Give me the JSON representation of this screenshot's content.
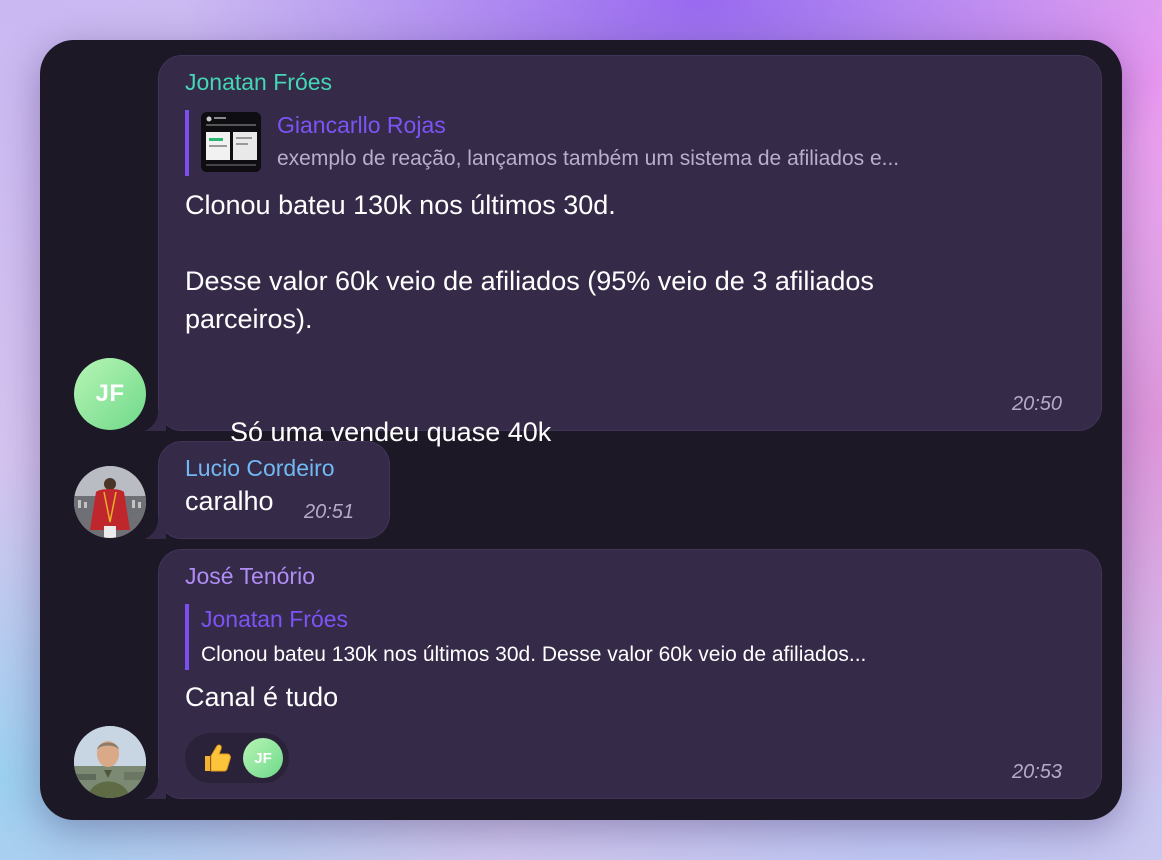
{
  "colors": {
    "window_bg": "#1c1826",
    "bubble_bg": "#352a48",
    "sender_green": "#44d7b6",
    "sender_blue": "#72b8f2",
    "sender_purple": "#b08cf5",
    "reply_accent": "#7c54f5"
  },
  "messages": [
    {
      "sender": "Jonatan Fróes",
      "avatar_initials": "JF",
      "reply": {
        "name": "Giancarllo Rojas",
        "text": "exemplo de reação, lançamos também um sistema de afiliados e..."
      },
      "lines": {
        "l1": "Clonou bateu 130k nos últimos 30d.",
        "l2": "Desse valor 60k veio de afiliados (95% veio de 3 afiliados",
        "l3": "parceiros).",
        "l4": "Só uma vendeu quase 40k"
      },
      "emoji_icon": "grimacing-face-icon",
      "time": "20:50"
    },
    {
      "sender": "Lucio Cordeiro",
      "text": "caralho",
      "time": "20:51"
    },
    {
      "sender": "José Tenório",
      "reply": {
        "name": "Jonatan Fróes",
        "text": "Clonou bateu 130k nos últimos 30d.   Desse valor 60k veio de afiliados..."
      },
      "text": "Canal é tudo",
      "reaction": {
        "emoji_icon": "thumbs-up-icon",
        "user_initials": "JF"
      },
      "time": "20:53"
    }
  ]
}
